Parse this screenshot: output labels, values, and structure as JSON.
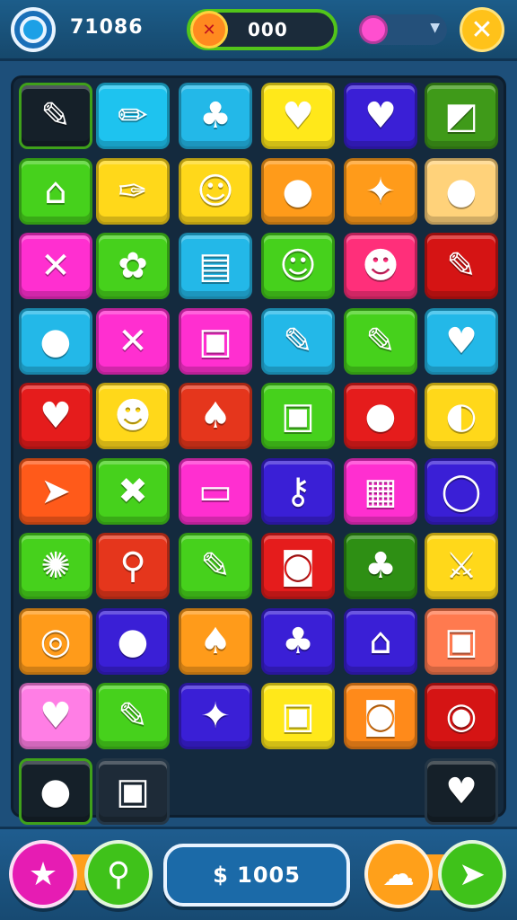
{
  "hud": {
    "score": "71086",
    "energy_value": "000",
    "avatar_icon": "ring-icon",
    "energy_icon": "crossed-tag-icon",
    "gem_icon": "pink-gem-icon",
    "dropdown_icon": "chevron-down-icon",
    "close_icon": "close-icon",
    "close_glyph": "✕",
    "energy_glyph": "✕",
    "dropdown_glyph": "▼"
  },
  "board": {
    "rows": [
      [
        {
          "icon": "brush-icon",
          "glyph": "✎",
          "color": "#152029"
        },
        {
          "icon": "pencil-icon",
          "glyph": "✏",
          "color": "#1ec3ef"
        },
        {
          "icon": "carrot-icon",
          "glyph": "♣",
          "color": "#23b8e8"
        },
        {
          "icon": "heart-icon",
          "glyph": "♥",
          "color": "#ffe81a"
        },
        {
          "icon": "heart-icon",
          "glyph": "♥",
          "color": "#3a1fd6"
        },
        {
          "icon": "pink-square-icon",
          "glyph": "◩",
          "color": "#3f9a19"
        }
      ],
      [
        {
          "icon": "house-icon",
          "glyph": "⌂",
          "color": "#46d11c"
        },
        {
          "icon": "screwdriver-icon",
          "glyph": "✑",
          "color": "#ffd81a"
        },
        {
          "icon": "smiley-blob-icon",
          "glyph": "☺",
          "color": "#ffd81a"
        },
        {
          "icon": "orange-ball-icon",
          "glyph": "●",
          "color": "#ff9b1a"
        },
        {
          "icon": "wrench-icon",
          "glyph": "✦",
          "color": "#ff9b1a"
        },
        {
          "icon": "green-blob-icon",
          "glyph": "●",
          "color": "#ffd27a"
        }
      ],
      [
        {
          "icon": "cross-icon",
          "glyph": "✕",
          "color": "#ff2fd0"
        },
        {
          "icon": "yellow-flower-icon",
          "glyph": "✿",
          "color": "#46d11c"
        },
        {
          "icon": "document-icon",
          "glyph": "▤",
          "color": "#23b8e8"
        },
        {
          "icon": "smiley-face-icon",
          "glyph": "☺",
          "color": "#46d11c"
        },
        {
          "icon": "yellow-face-icon",
          "glyph": "☻",
          "color": "#ff2f7a"
        },
        {
          "icon": "purple-marker-icon",
          "glyph": "✎",
          "color": "#d51414"
        }
      ],
      [
        {
          "icon": "red-fruit-icon",
          "glyph": "●",
          "color": "#23b8e8"
        },
        {
          "icon": "cross-icon",
          "glyph": "✕",
          "color": "#ff2fd0"
        },
        {
          "icon": "cookie-icon",
          "glyph": "▣",
          "color": "#ff2fd0"
        },
        {
          "icon": "paint-brush-icon",
          "glyph": "✎",
          "color": "#23b8e8"
        },
        {
          "icon": "marker-icon",
          "glyph": "✎",
          "color": "#46d11c"
        },
        {
          "icon": "heart-icon",
          "glyph": "♥",
          "color": "#23b8e8"
        }
      ],
      [
        {
          "icon": "heart-icon",
          "glyph": "♥",
          "color": "#e51c1c"
        },
        {
          "icon": "robot-face-icon",
          "glyph": "☻",
          "color": "#ffd81a"
        },
        {
          "icon": "leaf-icon",
          "glyph": "♠",
          "color": "#e5361c"
        },
        {
          "icon": "paw-box-icon",
          "glyph": "▣",
          "color": "#46d11c"
        },
        {
          "icon": "chat-bubble-icon",
          "glyph": "●",
          "color": "#e51c1c"
        },
        {
          "icon": "beach-ball-icon",
          "glyph": "◐",
          "color": "#ffd81a"
        }
      ],
      [
        {
          "icon": "green-arrow-icon",
          "glyph": "➤",
          "color": "#ff5a1a"
        },
        {
          "icon": "pink-x-icon",
          "glyph": "✖",
          "color": "#46d11c"
        },
        {
          "icon": "screen-icon",
          "glyph": "▭",
          "color": "#ff2fd0"
        },
        {
          "icon": "key-icon",
          "glyph": "⚷",
          "color": "#3a1fd6"
        },
        {
          "icon": "briefcase-icon",
          "glyph": "▦",
          "color": "#ff2fd0"
        },
        {
          "icon": "speech-bubble-icon",
          "glyph": "◯",
          "color": "#3a1fd6"
        }
      ],
      [
        {
          "icon": "shell-icon",
          "glyph": "✺",
          "color": "#46d11c"
        },
        {
          "icon": "magnifier-icon",
          "glyph": "⚲",
          "color": "#e5361c"
        },
        {
          "icon": "crayon-icon",
          "glyph": "✎",
          "color": "#46d11c"
        },
        {
          "icon": "speaker-box-icon",
          "glyph": "◙",
          "color": "#e51c1c"
        },
        {
          "icon": "carrot-icon",
          "glyph": "♣",
          "color": "#2e8f14"
        },
        {
          "icon": "sword-icon",
          "glyph": "⚔",
          "color": "#ffd81a"
        }
      ],
      [
        {
          "icon": "lollipop-icon",
          "glyph": "◎",
          "color": "#ff9b1a"
        },
        {
          "icon": "beads-icon",
          "glyph": "●",
          "color": "#3a1fd6"
        },
        {
          "icon": "green-leaf-icon",
          "glyph": "♠",
          "color": "#ff9b1a"
        },
        {
          "icon": "carrot-icon",
          "glyph": "♣",
          "color": "#3a1fd6"
        },
        {
          "icon": "house-icon",
          "glyph": "⌂",
          "color": "#3a1fd6"
        },
        {
          "icon": "robot-box-icon",
          "glyph": "▣",
          "color": "#ff7a4f"
        }
      ],
      [
        {
          "icon": "heart-icon",
          "glyph": "♥",
          "color": "#ff7ee5"
        },
        {
          "icon": "crayon-icon",
          "glyph": "✎",
          "color": "#46d11c"
        },
        {
          "icon": "wrench-icon",
          "glyph": "✦",
          "color": "#3a1fd6"
        },
        {
          "icon": "pink-box-icon",
          "glyph": "▣",
          "color": "#ffe81a"
        },
        {
          "icon": "camera-icon",
          "glyph": "◙",
          "color": "#ff8a1a"
        },
        {
          "icon": "donut-icon",
          "glyph": "◉",
          "color": "#d51414"
        }
      ],
      [
        {
          "icon": "beads-icon",
          "glyph": "●",
          "color": "#152029"
        },
        {
          "icon": "kettle-icon",
          "glyph": "▣",
          "color": "#1e2b38"
        },
        null,
        null,
        null,
        {
          "icon": "heart-icon",
          "glyph": "♥",
          "color": "#152029"
        }
      ]
    ]
  },
  "bottom": {
    "star_icon": "star-icon",
    "star_glyph": "★",
    "search_icon": "magnifier-icon",
    "search_glyph": "⚲",
    "coins_label": "$ 1005",
    "chef_icon": "chef-hat-icon",
    "chef_glyph": "☁",
    "send_icon": "paper-plane-icon",
    "send_glyph": "➤"
  }
}
